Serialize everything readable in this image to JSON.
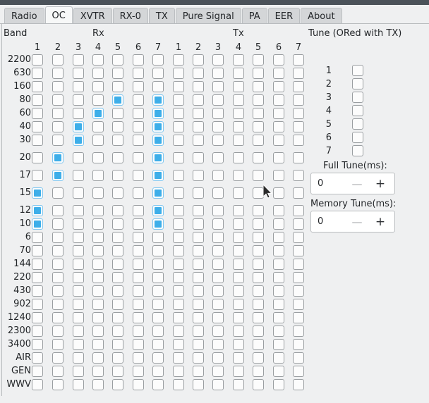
{
  "window": {
    "titlebar_color": "#4b5259",
    "background_color": "#eff0f1",
    "accent_color": "#3daee9"
  },
  "tabs": [
    {
      "label": "Radio",
      "active": false
    },
    {
      "label": "OC",
      "active": true
    },
    {
      "label": "XVTR",
      "active": false
    },
    {
      "label": "RX-0",
      "active": false
    },
    {
      "label": "TX",
      "active": false
    },
    {
      "label": "Pure Signal",
      "active": false
    },
    {
      "label": "PA",
      "active": false
    },
    {
      "label": "EER",
      "active": false
    },
    {
      "label": "About",
      "active": false
    }
  ],
  "headers": {
    "band": "Band",
    "rx": "Rx",
    "tx": "Tx",
    "tune": "Tune (ORed with TX)"
  },
  "column_numbers": [
    "1",
    "2",
    "3",
    "4",
    "5",
    "6",
    "7"
  ],
  "bands": [
    "2200",
    "630",
    "160",
    "80",
    "60",
    "40",
    "30",
    "20",
    "17",
    "15",
    "12",
    "10",
    "6",
    "70",
    "144",
    "220",
    "430",
    "902",
    "1240",
    "2300",
    "3400",
    "AIR",
    "GEN",
    "WWV"
  ],
  "rx_matrix": [
    [
      0,
      0,
      0,
      0,
      0,
      0,
      0
    ],
    [
      0,
      0,
      0,
      0,
      0,
      0,
      0
    ],
    [
      0,
      0,
      0,
      0,
      0,
      0,
      0
    ],
    [
      0,
      0,
      0,
      0,
      1,
      0,
      1
    ],
    [
      0,
      0,
      0,
      1,
      0,
      0,
      1
    ],
    [
      0,
      0,
      1,
      0,
      0,
      0,
      1
    ],
    [
      0,
      0,
      1,
      0,
      0,
      0,
      1
    ],
    [
      0,
      1,
      0,
      0,
      0,
      0,
      1
    ],
    [
      0,
      1,
      0,
      0,
      0,
      0,
      1
    ],
    [
      1,
      0,
      0,
      0,
      0,
      0,
      1
    ],
    [
      1,
      0,
      0,
      0,
      0,
      0,
      1
    ],
    [
      1,
      0,
      0,
      0,
      0,
      0,
      1
    ],
    [
      0,
      0,
      0,
      0,
      0,
      0,
      0
    ],
    [
      0,
      0,
      0,
      0,
      0,
      0,
      0
    ],
    [
      0,
      0,
      0,
      0,
      0,
      0,
      0
    ],
    [
      0,
      0,
      0,
      0,
      0,
      0,
      0
    ],
    [
      0,
      0,
      0,
      0,
      0,
      0,
      0
    ],
    [
      0,
      0,
      0,
      0,
      0,
      0,
      0
    ],
    [
      0,
      0,
      0,
      0,
      0,
      0,
      0
    ],
    [
      0,
      0,
      0,
      0,
      0,
      0,
      0
    ],
    [
      0,
      0,
      0,
      0,
      0,
      0,
      0
    ],
    [
      0,
      0,
      0,
      0,
      0,
      0,
      0
    ],
    [
      0,
      0,
      0,
      0,
      0,
      0,
      0
    ],
    [
      0,
      0,
      0,
      0,
      0,
      0,
      0
    ]
  ],
  "tx_matrix": [
    [
      0,
      0,
      0,
      0,
      0,
      0,
      0
    ],
    [
      0,
      0,
      0,
      0,
      0,
      0,
      0
    ],
    [
      0,
      0,
      0,
      0,
      0,
      0,
      0
    ],
    [
      0,
      0,
      0,
      0,
      0,
      0,
      0
    ],
    [
      0,
      0,
      0,
      0,
      0,
      0,
      0
    ],
    [
      0,
      0,
      0,
      0,
      0,
      0,
      0
    ],
    [
      0,
      0,
      0,
      0,
      0,
      0,
      0
    ],
    [
      0,
      0,
      0,
      0,
      0,
      0,
      0
    ],
    [
      0,
      0,
      0,
      0,
      0,
      0,
      0
    ],
    [
      0,
      0,
      0,
      0,
      0,
      0,
      0
    ],
    [
      0,
      0,
      0,
      0,
      0,
      0,
      0
    ],
    [
      0,
      0,
      0,
      0,
      0,
      0,
      0
    ],
    [
      0,
      0,
      0,
      0,
      0,
      0,
      0
    ],
    [
      0,
      0,
      0,
      0,
      0,
      0,
      0
    ],
    [
      0,
      0,
      0,
      0,
      0,
      0,
      0
    ],
    [
      0,
      0,
      0,
      0,
      0,
      0,
      0
    ],
    [
      0,
      0,
      0,
      0,
      0,
      0,
      0
    ],
    [
      0,
      0,
      0,
      0,
      0,
      0,
      0
    ],
    [
      0,
      0,
      0,
      0,
      0,
      0,
      0
    ],
    [
      0,
      0,
      0,
      0,
      0,
      0,
      0
    ],
    [
      0,
      0,
      0,
      0,
      0,
      0,
      0
    ],
    [
      0,
      0,
      0,
      0,
      0,
      0,
      0
    ],
    [
      0,
      0,
      0,
      0,
      0,
      0,
      0
    ],
    [
      0,
      0,
      0,
      0,
      0,
      0,
      0
    ]
  ],
  "tune": {
    "rows": [
      "1",
      "2",
      "3",
      "4",
      "5",
      "6",
      "7"
    ],
    "checked": [
      0,
      0,
      0,
      0,
      0,
      0,
      0
    ],
    "full_tune": {
      "label": "Full Tune(ms):",
      "value": "0",
      "minus": "—",
      "plus": "+"
    },
    "memory_tune": {
      "label": "Memory Tune(ms):",
      "value": "0",
      "minus": "—",
      "plus": "+"
    }
  }
}
